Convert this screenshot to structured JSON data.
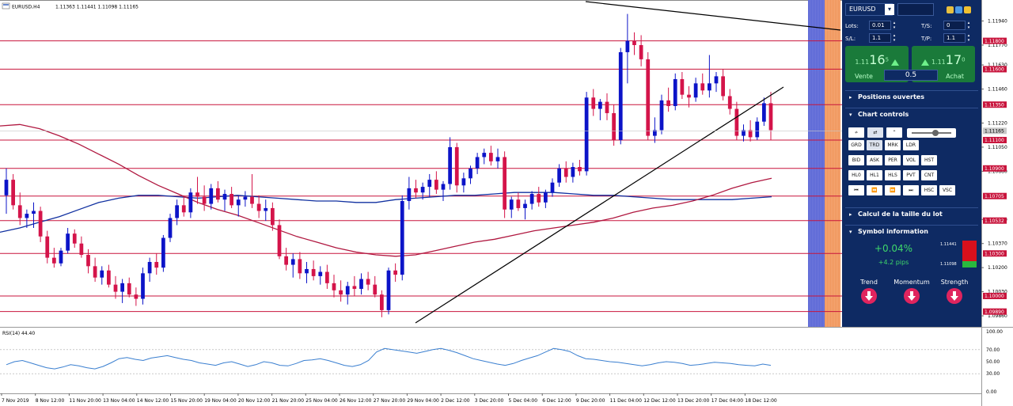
{
  "chart_header": {
    "symbol_timeframe": "EURUSD,H4",
    "ohlc": "1.11363 1.11441 1.11098 1.11165"
  },
  "rsi_header": "RSI(14) 44.40",
  "price_axis": {
    "ticks": [
      "1.11940",
      "1.11770",
      "1.11630",
      "1.11460",
      "1.11220",
      "1.11050",
      "1.10880",
      "1.10540",
      "1.10370",
      "1.10200",
      "1.10030",
      "1.09860"
    ],
    "tick_prices": [
      1.1194,
      1.1177,
      1.1163,
      1.1146,
      1.1122,
      1.1105,
      1.1088,
      1.1054,
      1.1037,
      1.102,
      1.1003,
      1.0986
    ],
    "current_price_label": "1.11165",
    "current_price": 1.11165
  },
  "rsi_axis": {
    "ticks": [
      "100.00",
      "70.00",
      "50.00",
      "30.00",
      "0.00"
    ],
    "values": [
      100,
      70,
      50,
      30,
      0
    ]
  },
  "time_axis": [
    "7 Nov 2019",
    "8 Nov 12:00",
    "11 Nov 20:00",
    "13 Nov 04:00",
    "14 Nov 12:00",
    "15 Nov 20:00",
    "19 Nov 04:00",
    "20 Nov 12:00",
    "21 Nov 20:00",
    "25 Nov 04:00",
    "26 Nov 12:00",
    "27 Nov 20:00",
    "29 Nov 04:00",
    "2 Dec 12:00",
    "3 Dec 20:00",
    "5 Dec 04:00",
    "6 Dec 12:00",
    "9 Dec 20:00",
    "11 Dec 04:00",
    "12 Dec 12:00",
    "13 Dec 20:00",
    "17 Dec 04:00",
    "18 Dec 12:00"
  ],
  "horizontal_levels": [
    {
      "label": "1.11800",
      "price": 1.118
    },
    {
      "label": "1.11600",
      "price": 1.116
    },
    {
      "label": "1.11350",
      "price": 1.1135
    },
    {
      "label": "1.11100",
      "price": 1.111
    },
    {
      "label": "1.10900",
      "price": 1.109
    },
    {
      "label": "1.10705",
      "price": 1.10705
    },
    {
      "label": "1.10532",
      "price": 1.10532
    },
    {
      "label": "1.10300",
      "price": 1.103
    },
    {
      "label": "1.10000",
      "price": 1.1
    },
    {
      "label": "1.09890",
      "price": 1.0989
    }
  ],
  "colors": {
    "bull": "#0c14c8",
    "bear": "#d4144a",
    "level": "#c8143c",
    "ma_fast": "#1030a0",
    "ma_slow": "#b01840",
    "rsi_line": "#3a7fd0",
    "panel_bg": "#0e2a63",
    "buy_green": "#1a7a3a",
    "indicator_red": "#e0245e"
  },
  "chart_data": {
    "type": "candlestick",
    "price_range": [
      1.0981,
      1.1201
    ],
    "candles": [
      [
        1.1071,
        1.109,
        1.1058,
        1.1082
      ],
      [
        1.1082,
        1.1086,
        1.1061,
        1.1064
      ],
      [
        1.1064,
        1.1073,
        1.105,
        1.1055
      ],
      [
        1.1055,
        1.1061,
        1.1048,
        1.1058
      ],
      [
        1.1058,
        1.1066,
        1.1048,
        1.106
      ],
      [
        1.106,
        1.1063,
        1.1038,
        1.1042
      ],
      [
        1.1042,
        1.1046,
        1.1023,
        1.1027
      ],
      [
        1.1027,
        1.1034,
        1.102,
        1.1023
      ],
      [
        1.1023,
        1.1034,
        1.1021,
        1.1032
      ],
      [
        1.1032,
        1.1048,
        1.103,
        1.1044
      ],
      [
        1.1044,
        1.1047,
        1.1034,
        1.1037
      ],
      [
        1.1037,
        1.1042,
        1.1027,
        1.1029
      ],
      [
        1.1029,
        1.1033,
        1.1016,
        1.1021
      ],
      [
        1.1021,
        1.1027,
        1.101,
        1.1013
      ],
      [
        1.1013,
        1.1021,
        1.1008,
        1.1018
      ],
      [
        1.1018,
        1.1022,
        1.1006,
        1.1008
      ],
      [
        1.1008,
        1.1014,
        1.0998,
        1.1003
      ],
      [
        1.1003,
        1.1012,
        1.0995,
        1.1009
      ],
      [
        1.1009,
        1.1013,
        1.0999,
        1.1001
      ],
      [
        1.1001,
        1.1006,
        1.0993,
        1.0998
      ],
      [
        1.0998,
        1.102,
        1.0994,
        1.1016
      ],
      [
        1.1016,
        1.1027,
        1.101,
        1.1024
      ],
      [
        1.1024,
        1.103,
        1.1015,
        1.102
      ],
      [
        1.102,
        1.1043,
        1.1017,
        1.1041
      ],
      [
        1.1041,
        1.1058,
        1.1038,
        1.1055
      ],
      [
        1.1055,
        1.1068,
        1.105,
        1.1064
      ],
      [
        1.1064,
        1.1071,
        1.1056,
        1.1059
      ],
      [
        1.1059,
        1.1076,
        1.1055,
        1.1073
      ],
      [
        1.1073,
        1.1084,
        1.1065,
        1.107
      ],
      [
        1.107,
        1.1078,
        1.106,
        1.1065
      ],
      [
        1.1065,
        1.1079,
        1.1061,
        1.1076
      ],
      [
        1.1076,
        1.1081,
        1.1066,
        1.1068
      ],
      [
        1.1068,
        1.1075,
        1.106,
        1.1072
      ],
      [
        1.1072,
        1.1077,
        1.1062,
        1.1064
      ],
      [
        1.1064,
        1.1071,
        1.1056,
        1.1068
      ],
      [
        1.1068,
        1.1074,
        1.1063,
        1.107
      ],
      [
        1.107,
        1.1086,
        1.1062,
        1.1065
      ],
      [
        1.1065,
        1.1071,
        1.1055,
        1.106
      ],
      [
        1.106,
        1.1068,
        1.1053,
        1.1062
      ],
      [
        1.1062,
        1.1066,
        1.1046,
        1.105
      ],
      [
        1.105,
        1.1054,
        1.1026,
        1.1028
      ],
      [
        1.1028,
        1.1034,
        1.1018,
        1.1022
      ],
      [
        1.1022,
        1.103,
        1.1013,
        1.1026
      ],
      [
        1.1026,
        1.1031,
        1.1012,
        1.1016
      ],
      [
        1.1016,
        1.1024,
        1.1009,
        1.1019
      ],
      [
        1.1019,
        1.1025,
        1.1011,
        1.1014
      ],
      [
        1.1014,
        1.1021,
        1.1008,
        1.1017
      ],
      [
        1.1017,
        1.1022,
        1.1005,
        1.1009
      ],
      [
        1.1009,
        1.1015,
        1.0999,
        1.1004
      ],
      [
        1.1004,
        1.1011,
        1.0996,
        1.1001
      ],
      [
        1.1001,
        1.101,
        1.0994,
        1.1007
      ],
      [
        1.1007,
        1.1014,
        1.1,
        1.1005
      ],
      [
        1.1005,
        1.1016,
        1.1001,
        1.1012
      ],
      [
        1.1012,
        1.1017,
        1.1004,
        1.1008
      ],
      [
        1.1008,
        1.1014,
        1.0999,
        1.1001
      ],
      [
        1.1001,
        1.1004,
        1.0985,
        1.099
      ],
      [
        1.099,
        1.102,
        1.0987,
        1.1018
      ],
      [
        1.1018,
        1.1023,
        1.101,
        1.1015
      ],
      [
        1.1015,
        1.1071,
        1.1011,
        1.1067
      ],
      [
        1.1067,
        1.1084,
        1.1061,
        1.1076
      ],
      [
        1.1076,
        1.1082,
        1.1069,
        1.1073
      ],
      [
        1.1073,
        1.108,
        1.1068,
        1.1077
      ],
      [
        1.1077,
        1.1086,
        1.107,
        1.1082
      ],
      [
        1.1082,
        1.1088,
        1.1072,
        1.1075
      ],
      [
        1.1075,
        1.1081,
        1.1067,
        1.1079
      ],
      [
        1.1079,
        1.1112,
        1.1075,
        1.1105
      ],
      [
        1.1105,
        1.1108,
        1.1073,
        1.1078
      ],
      [
        1.1078,
        1.1087,
        1.1073,
        1.1083
      ],
      [
        1.1083,
        1.1092,
        1.1079,
        1.109
      ],
      [
        1.109,
        1.1101,
        1.1086,
        1.1098
      ],
      [
        1.1098,
        1.1104,
        1.1093,
        1.1101
      ],
      [
        1.1101,
        1.1106,
        1.1092,
        1.1095
      ],
      [
        1.1095,
        1.1104,
        1.109,
        1.1098
      ],
      [
        1.1098,
        1.1102,
        1.1055,
        1.1061
      ],
      [
        1.1061,
        1.107,
        1.1055,
        1.1068
      ],
      [
        1.1068,
        1.1073,
        1.106,
        1.1062
      ],
      [
        1.1062,
        1.1068,
        1.1054,
        1.1065
      ],
      [
        1.1065,
        1.1074,
        1.1061,
        1.1072
      ],
      [
        1.1072,
        1.1077,
        1.1063,
        1.1066
      ],
      [
        1.1066,
        1.1075,
        1.1062,
        1.1073
      ],
      [
        1.1073,
        1.1083,
        1.107,
        1.108
      ],
      [
        1.108,
        1.1093,
        1.1077,
        1.109
      ],
      [
        1.109,
        1.1095,
        1.108,
        1.1084
      ],
      [
        1.1084,
        1.1094,
        1.108,
        1.1091
      ],
      [
        1.1091,
        1.1096,
        1.1085,
        1.1088
      ],
      [
        1.1088,
        1.1144,
        1.1085,
        1.114
      ],
      [
        1.114,
        1.1146,
        1.1127,
        1.1132
      ],
      [
        1.1132,
        1.1139,
        1.1124,
        1.1137
      ],
      [
        1.1137,
        1.1143,
        1.1124,
        1.1129
      ],
      [
        1.1129,
        1.1135,
        1.1106,
        1.111
      ],
      [
        1.111,
        1.1175,
        1.1107,
        1.1172
      ],
      [
        1.1172,
        1.1199,
        1.115,
        1.118
      ],
      [
        1.118,
        1.1186,
        1.117,
        1.1177
      ],
      [
        1.1177,
        1.1184,
        1.1162,
        1.1167
      ],
      [
        1.1167,
        1.1172,
        1.111,
        1.1113
      ],
      [
        1.1113,
        1.1126,
        1.1108,
        1.1117
      ],
      [
        1.1117,
        1.1142,
        1.1114,
        1.1138
      ],
      [
        1.1138,
        1.1147,
        1.113,
        1.1134
      ],
      [
        1.1134,
        1.1157,
        1.1131,
        1.1153
      ],
      [
        1.1153,
        1.1158,
        1.1139,
        1.1142
      ],
      [
        1.1142,
        1.1148,
        1.1133,
        1.114
      ],
      [
        1.114,
        1.1154,
        1.1137,
        1.115
      ],
      [
        1.115,
        1.1157,
        1.1142,
        1.1145
      ],
      [
        1.1145,
        1.117,
        1.114,
        1.115
      ],
      [
        1.115,
        1.1158,
        1.1144,
        1.1155
      ],
      [
        1.1155,
        1.116,
        1.1138,
        1.1141
      ],
      [
        1.1141,
        1.1146,
        1.1128,
        1.1132
      ],
      [
        1.1132,
        1.1137,
        1.111,
        1.1113
      ],
      [
        1.1113,
        1.1121,
        1.1109,
        1.1117
      ],
      [
        1.1117,
        1.1124,
        1.1109,
        1.1112
      ],
      [
        1.1112,
        1.1126,
        1.111,
        1.1123
      ],
      [
        1.1123,
        1.114,
        1.112,
        1.1136
      ],
      [
        1.1136,
        1.1144,
        1.111,
        1.1117
      ]
    ],
    "ma_fast": [
      1.1045,
      1.1048,
      1.1052,
      1.1056,
      1.1061,
      1.1066,
      1.1069,
      1.1071,
      1.1071,
      1.107,
      1.1069,
      1.107,
      1.1071,
      1.107,
      1.1069,
      1.1068,
      1.1067,
      1.1067,
      1.1066,
      1.1066,
      1.1068,
      1.1069,
      1.107,
      1.1071,
      1.1071,
      1.1072,
      1.1073,
      1.1073,
      1.1073,
      1.1072,
      1.1071,
      1.1071,
      1.107,
      1.1069,
      1.1068,
      1.1068,
      1.1068,
      1.1068,
      1.1069,
      1.107
    ],
    "ma_slow": [
      1.112,
      1.1121,
      1.1118,
      1.1113,
      1.1107,
      1.11,
      1.1093,
      1.1085,
      1.1078,
      1.1072,
      1.1066,
      1.1061,
      1.1057,
      1.1052,
      1.1047,
      1.1042,
      1.1038,
      1.1034,
      1.1031,
      1.1029,
      1.1028,
      1.1029,
      1.1032,
      1.1035,
      1.1038,
      1.104,
      1.1043,
      1.1046,
      1.1048,
      1.105,
      1.1052,
      1.1055,
      1.1059,
      1.1062,
      1.1064,
      1.1067,
      1.1071,
      1.1076,
      1.108,
      1.1083
    ],
    "rsi": [
      45,
      50,
      52,
      48,
      44,
      40,
      38,
      41,
      45,
      43,
      40,
      38,
      42,
      48,
      55,
      57,
      54,
      52,
      56,
      58,
      60,
      57,
      54,
      52,
      48,
      46,
      44,
      48,
      50,
      46,
      42,
      45,
      50,
      48,
      44,
      43,
      47,
      52,
      53,
      55,
      52,
      48,
      44,
      42,
      45,
      52,
      66,
      72,
      70,
      68,
      66,
      64,
      67,
      70,
      72,
      69,
      65,
      60,
      55,
      52,
      49,
      46,
      44,
      47,
      52,
      56,
      60,
      66,
      72,
      70,
      67,
      60,
      55,
      54,
      52,
      50,
      49,
      47,
      45,
      43,
      45,
      48,
      50,
      49,
      47,
      44,
      45,
      47,
      49,
      48,
      47,
      45,
      44,
      43,
      46,
      44
    ]
  },
  "panel": {
    "symbol": "EURUSD",
    "symbol_dd_glyph": "▾",
    "lots_label": "Lots:",
    "lots_value": "0.01",
    "ts_label": "T/S:",
    "ts_value": "0",
    "sl_label": "S/L:",
    "sl_value": "1.1",
    "tp_label": "T/P:",
    "tp_value": "1.1",
    "sell": {
      "prefix": "1.11",
      "big": "16",
      "sup": "5",
      "label": "Vente"
    },
    "buy": {
      "prefix": "1.11",
      "big": "17",
      "sup": "0",
      "label": "Achat"
    },
    "spread": "0.5",
    "sections": {
      "positions": "Positions ouvertes",
      "chart_controls": "Chart controls",
      "lot_calc": "Calcul de la taille du lot",
      "symbol_info": "Symbol information"
    },
    "caret_right": "▸",
    "caret_down": "▾",
    "controls_row1": [
      "≁",
      "⇄",
      "⌃"
    ],
    "controls_row2": [
      "GRD",
      "TRD",
      "MRK",
      "LDR"
    ],
    "controls_row3": [
      "BID",
      "ASK",
      "PER",
      "VOL",
      "HST"
    ],
    "controls_row4": [
      "HL0",
      "HL1",
      "HLS",
      "PVT",
      "CNT"
    ],
    "controls_row5": [
      "⏮",
      "⏪",
      "⏩",
      "⏭",
      "HSC",
      "VSC"
    ],
    "slider_level": 0.6,
    "symbol_info": {
      "change_pct": "+0.04%",
      "change_pips": "+4.2 pips",
      "high": "1.11441",
      "low": "1.11098",
      "bar_bear_fraction": 0.75
    },
    "indicators": [
      {
        "label": "Trend",
        "direction": "down"
      },
      {
        "label": "Momentum",
        "direction": "down"
      },
      {
        "label": "Strength",
        "direction": "down"
      }
    ]
  }
}
